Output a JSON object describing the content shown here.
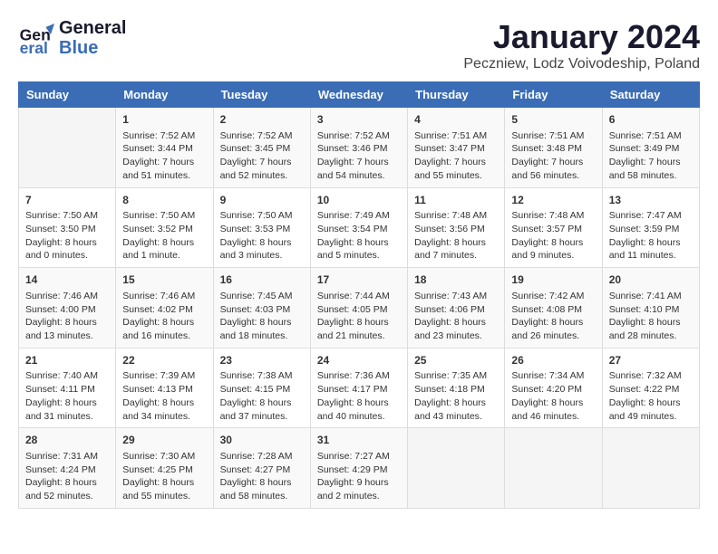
{
  "logo": {
    "line1": "General",
    "line2": "Blue"
  },
  "title": "January 2024",
  "subtitle": "Peczniew, Lodz Voivodeship, Poland",
  "days_header": [
    "Sunday",
    "Monday",
    "Tuesday",
    "Wednesday",
    "Thursday",
    "Friday",
    "Saturday"
  ],
  "weeks": [
    [
      {
        "day": "",
        "info": ""
      },
      {
        "day": "1",
        "info": "Sunrise: 7:52 AM\nSunset: 3:44 PM\nDaylight: 7 hours\nand 51 minutes."
      },
      {
        "day": "2",
        "info": "Sunrise: 7:52 AM\nSunset: 3:45 PM\nDaylight: 7 hours\nand 52 minutes."
      },
      {
        "day": "3",
        "info": "Sunrise: 7:52 AM\nSunset: 3:46 PM\nDaylight: 7 hours\nand 54 minutes."
      },
      {
        "day": "4",
        "info": "Sunrise: 7:51 AM\nSunset: 3:47 PM\nDaylight: 7 hours\nand 55 minutes."
      },
      {
        "day": "5",
        "info": "Sunrise: 7:51 AM\nSunset: 3:48 PM\nDaylight: 7 hours\nand 56 minutes."
      },
      {
        "day": "6",
        "info": "Sunrise: 7:51 AM\nSunset: 3:49 PM\nDaylight: 7 hours\nand 58 minutes."
      }
    ],
    [
      {
        "day": "7",
        "info": "Sunrise: 7:50 AM\nSunset: 3:50 PM\nDaylight: 8 hours\nand 0 minutes."
      },
      {
        "day": "8",
        "info": "Sunrise: 7:50 AM\nSunset: 3:52 PM\nDaylight: 8 hours\nand 1 minute."
      },
      {
        "day": "9",
        "info": "Sunrise: 7:50 AM\nSunset: 3:53 PM\nDaylight: 8 hours\nand 3 minutes."
      },
      {
        "day": "10",
        "info": "Sunrise: 7:49 AM\nSunset: 3:54 PM\nDaylight: 8 hours\nand 5 minutes."
      },
      {
        "day": "11",
        "info": "Sunrise: 7:48 AM\nSunset: 3:56 PM\nDaylight: 8 hours\nand 7 minutes."
      },
      {
        "day": "12",
        "info": "Sunrise: 7:48 AM\nSunset: 3:57 PM\nDaylight: 8 hours\nand 9 minutes."
      },
      {
        "day": "13",
        "info": "Sunrise: 7:47 AM\nSunset: 3:59 PM\nDaylight: 8 hours\nand 11 minutes."
      }
    ],
    [
      {
        "day": "14",
        "info": "Sunrise: 7:46 AM\nSunset: 4:00 PM\nDaylight: 8 hours\nand 13 minutes."
      },
      {
        "day": "15",
        "info": "Sunrise: 7:46 AM\nSunset: 4:02 PM\nDaylight: 8 hours\nand 16 minutes."
      },
      {
        "day": "16",
        "info": "Sunrise: 7:45 AM\nSunset: 4:03 PM\nDaylight: 8 hours\nand 18 minutes."
      },
      {
        "day": "17",
        "info": "Sunrise: 7:44 AM\nSunset: 4:05 PM\nDaylight: 8 hours\nand 21 minutes."
      },
      {
        "day": "18",
        "info": "Sunrise: 7:43 AM\nSunset: 4:06 PM\nDaylight: 8 hours\nand 23 minutes."
      },
      {
        "day": "19",
        "info": "Sunrise: 7:42 AM\nSunset: 4:08 PM\nDaylight: 8 hours\nand 26 minutes."
      },
      {
        "day": "20",
        "info": "Sunrise: 7:41 AM\nSunset: 4:10 PM\nDaylight: 8 hours\nand 28 minutes."
      }
    ],
    [
      {
        "day": "21",
        "info": "Sunrise: 7:40 AM\nSunset: 4:11 PM\nDaylight: 8 hours\nand 31 minutes."
      },
      {
        "day": "22",
        "info": "Sunrise: 7:39 AM\nSunset: 4:13 PM\nDaylight: 8 hours\nand 34 minutes."
      },
      {
        "day": "23",
        "info": "Sunrise: 7:38 AM\nSunset: 4:15 PM\nDaylight: 8 hours\nand 37 minutes."
      },
      {
        "day": "24",
        "info": "Sunrise: 7:36 AM\nSunset: 4:17 PM\nDaylight: 8 hours\nand 40 minutes."
      },
      {
        "day": "25",
        "info": "Sunrise: 7:35 AM\nSunset: 4:18 PM\nDaylight: 8 hours\nand 43 minutes."
      },
      {
        "day": "26",
        "info": "Sunrise: 7:34 AM\nSunset: 4:20 PM\nDaylight: 8 hours\nand 46 minutes."
      },
      {
        "day": "27",
        "info": "Sunrise: 7:32 AM\nSunset: 4:22 PM\nDaylight: 8 hours\nand 49 minutes."
      }
    ],
    [
      {
        "day": "28",
        "info": "Sunrise: 7:31 AM\nSunset: 4:24 PM\nDaylight: 8 hours\nand 52 minutes."
      },
      {
        "day": "29",
        "info": "Sunrise: 7:30 AM\nSunset: 4:25 PM\nDaylight: 8 hours\nand 55 minutes."
      },
      {
        "day": "30",
        "info": "Sunrise: 7:28 AM\nSunset: 4:27 PM\nDaylight: 8 hours\nand 58 minutes."
      },
      {
        "day": "31",
        "info": "Sunrise: 7:27 AM\nSunset: 4:29 PM\nDaylight: 9 hours\nand 2 minutes."
      },
      {
        "day": "",
        "info": ""
      },
      {
        "day": "",
        "info": ""
      },
      {
        "day": "",
        "info": ""
      }
    ]
  ]
}
